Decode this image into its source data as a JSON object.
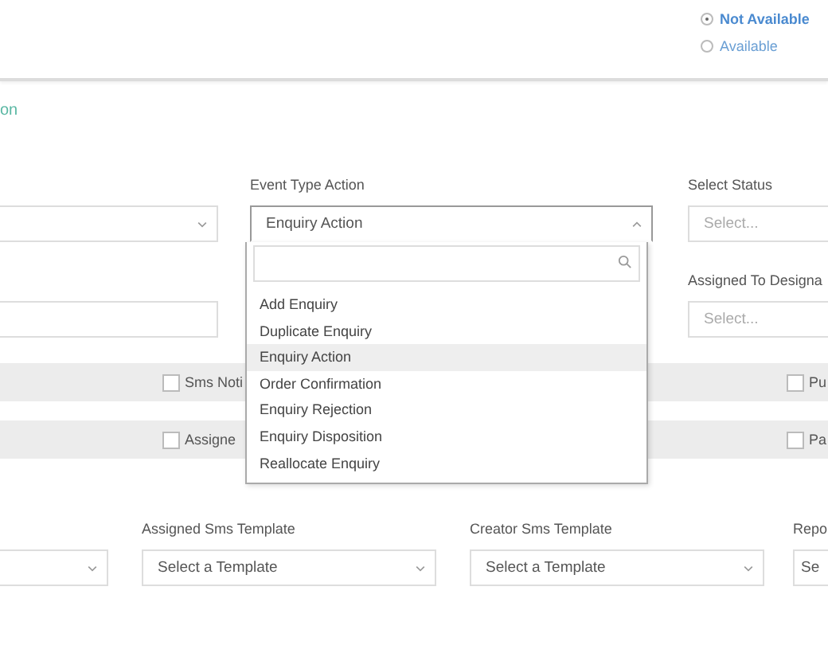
{
  "availability": [
    {
      "label": "Not Available",
      "selected": true
    },
    {
      "label": "Available",
      "selected": false
    }
  ],
  "section_title": "on",
  "field_rows": [
    {
      "fields": [
        {
          "kind": "select",
          "caret": true
        },
        {
          "kind": "select",
          "label": "Event Type Action",
          "value": "Enquiry Action",
          "caret": true,
          "expanded": true
        },
        {
          "kind": "select",
          "label": "Select Status",
          "placeholder": "Select..."
        }
      ]
    },
    {
      "fields": [
        {
          "kind": "text"
        },
        {
          "kind": "hidden"
        },
        {
          "kind": "select",
          "label": "Assigned To Designa",
          "placeholder": "Select..."
        }
      ]
    }
  ],
  "dropdown": {
    "options": [
      {
        "label": "Add Enquiry",
        "selected": false
      },
      {
        "label": "Duplicate Enquiry",
        "selected": false
      },
      {
        "label": "Enquiry Action",
        "selected": true
      },
      {
        "label": "Order Confirmation",
        "selected": false
      },
      {
        "label": "Enquiry Rejection",
        "selected": false
      },
      {
        "label": "Enquiry Disposition",
        "selected": false
      },
      {
        "label": "Reallocate Enquiry",
        "selected": false
      }
    ]
  },
  "check_bands": [
    {
      "items": [
        {
          "label": "Sms Noti",
          "checked": false
        },
        {
          "label": "Pu",
          "checked": false
        }
      ]
    },
    {
      "items": [
        {
          "label": "Assigne",
          "checked": false
        },
        {
          "label": "Pa",
          "checked": false
        }
      ]
    }
  ],
  "template_row": [
    {
      "kind": "select",
      "caret": true
    },
    {
      "kind": "select",
      "label": "Assigned Sms Template",
      "value": "Select a Template",
      "caret": true
    },
    {
      "kind": "select",
      "label": "Creator Sms Template",
      "value": "Select a Template",
      "caret": true
    },
    {
      "kind": "select",
      "label": "Repo",
      "value": "Se"
    }
  ]
}
